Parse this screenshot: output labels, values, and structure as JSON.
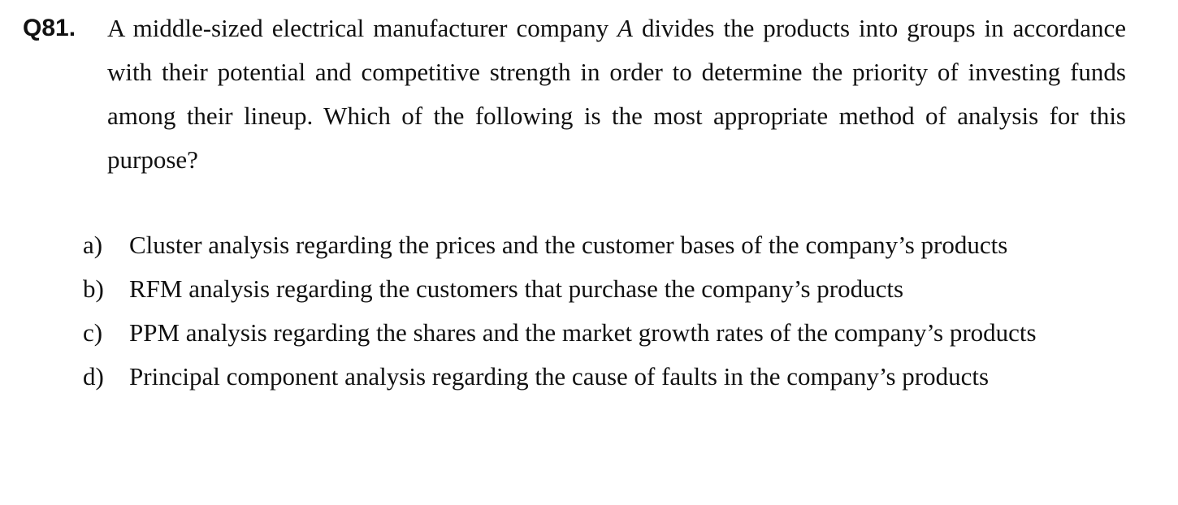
{
  "question": {
    "number": "Q81.",
    "text_before": "A middle-sized electrical manufacturer company ",
    "variable": "A",
    "text_after": " divides the products into groups in accordance with their potential and competitive strength in order to determine the priority of investing funds among their lineup. Which of the following is the most appropriate method of analysis for this purpose?"
  },
  "options": [
    {
      "letter": "a)",
      "text": "Cluster analysis regarding the prices and the customer bases of the company’s products"
    },
    {
      "letter": "b)",
      "text": "RFM analysis regarding the customers that purchase the company’s products"
    },
    {
      "letter": "c)",
      "text": "PPM analysis regarding the shares and the market growth rates of the company’s products"
    },
    {
      "letter": "d)",
      "text": "Principal component analysis regarding the cause of faults in the company’s products"
    }
  ]
}
